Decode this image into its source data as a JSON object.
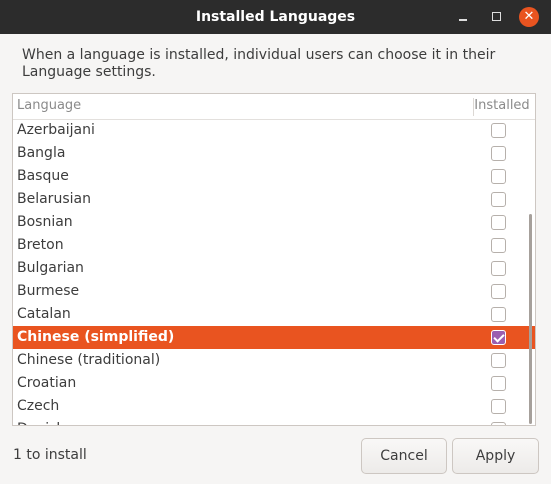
{
  "window": {
    "title": "Installed Languages",
    "close_glyph": "✕"
  },
  "description": "When a language is installed, individual users can choose it in their Language settings.",
  "list": {
    "columns": {
      "language": "Language",
      "installed": "Installed"
    },
    "rows": [
      {
        "label": "Azerbaijani",
        "installed": false
      },
      {
        "label": "Bangla",
        "installed": false
      },
      {
        "label": "Basque",
        "installed": false
      },
      {
        "label": "Belarusian",
        "installed": false
      },
      {
        "label": "Bosnian",
        "installed": false
      },
      {
        "label": "Breton",
        "installed": false
      },
      {
        "label": "Bulgarian",
        "installed": false
      },
      {
        "label": "Burmese",
        "installed": false
      },
      {
        "label": "Catalan",
        "installed": false
      },
      {
        "label": "Chinese (simplified)",
        "installed": true,
        "selected": true
      },
      {
        "label": "Chinese (traditional)",
        "installed": false
      },
      {
        "label": "Croatian",
        "installed": false
      },
      {
        "label": "Czech",
        "installed": false
      },
      {
        "label": "Danish",
        "installed": false
      }
    ]
  },
  "footer": {
    "status": "1 to install",
    "cancel_label": "Cancel",
    "apply_label": "Apply"
  },
  "colors": {
    "selection": "#e95420",
    "titlebar": "#2c2c2c",
    "checked_box": "#9b5fb0"
  }
}
